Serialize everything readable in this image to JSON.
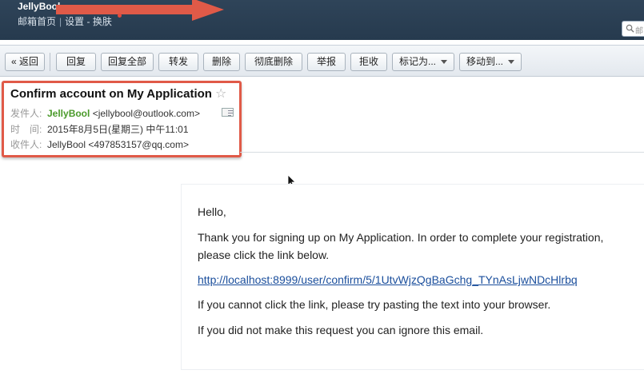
{
  "header": {
    "brand": "JellyBool",
    "nav": {
      "home": "邮箱首页",
      "settings": "设置",
      "dash": "-",
      "theme": "换肤"
    },
    "search_placeholder": "邮"
  },
  "toolbar": {
    "back": "« 返回",
    "reply": "回复",
    "reply_all": "回复全部",
    "forward": "转发",
    "delete": "删除",
    "delete_forever": "彻底删除",
    "report": "举报",
    "reject": "拒收",
    "mark_as": "标记为...",
    "move_to": "移动到..."
  },
  "mail": {
    "subject": "Confirm account on My Application",
    "from_label": "发件人:",
    "from_name": "JellyBool",
    "from_email": "<jellybool@outlook.com>",
    "time_label": "时　间:",
    "time": "2015年8月5日(星期三) 中午11:01",
    "to_label": "收件人:",
    "to": "JellyBool <497853157@qq.com>"
  },
  "body": {
    "greeting": "Hello,",
    "line1": "Thank you for signing up on My Application. In order to complete your registration, please click the link below.",
    "link": "http://localhost:8999/user/confirm/5/1UtvWjzQgBaGchg_TYnAsLjwNDcHlrbq",
    "line2": "If you cannot click the link, please try pasting the text into your browser.",
    "line3": "If you did not make this request you can ignore this email."
  },
  "colors": {
    "accent_annotation": "#e05a48",
    "sender": "#4a9a2a",
    "link": "#1a4e9c",
    "topbar": "#2b3f53"
  }
}
